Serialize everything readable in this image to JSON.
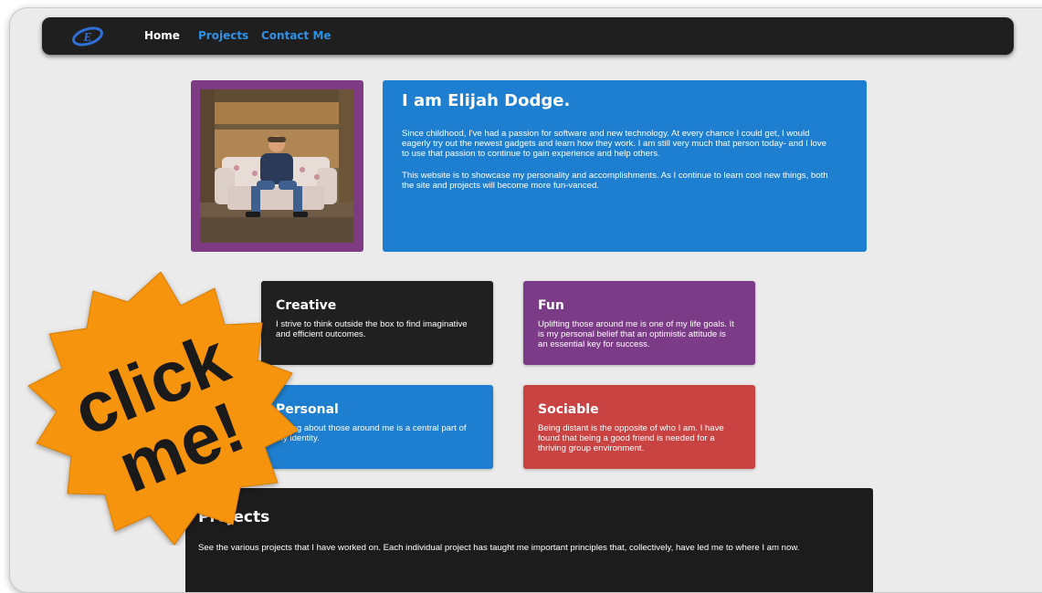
{
  "nav": {
    "links": [
      "Home",
      "Projects",
      "Contact Me"
    ]
  },
  "intro": {
    "title": "I am Elijah Dodge.",
    "paragraph1": "Since childhood, I've had a passion for software and new technology. At every chance I could get, I would eagerly try out the newest gadgets and learn how they work. I am still very much that person today- and I love to use that passion to continue to gain experience and help others.",
    "paragraph2": "This website is to showcase my personality and accomplishments. As I continue to learn cool new things, both the site and projects will become more fun-vanced."
  },
  "traits": [
    {
      "title": "Creative",
      "text": "I strive to think outside the box to find imaginative and efficient outcomes."
    },
    {
      "title": "Fun",
      "text": "Uplifting those around me is one of my life goals. It is my personal belief that an optimistic attitude is an essential key for success."
    },
    {
      "title": "Personal",
      "text": "Caring about those around me is a central part of my identity."
    },
    {
      "title": "Sociable",
      "text": "Being distant is the opposite of who I am. I have found that being a good friend is needed for a thriving group environment."
    }
  ],
  "projects": {
    "title": "Projects",
    "text": "See the various projects that I have worked on. Each individual project has taught me important principles that, collectively, have led me to where I am now."
  },
  "badge": {
    "line1": "click",
    "line2": "me!"
  },
  "colors": {
    "navbar": "#1f1f1f",
    "accent_blue": "#1e7fd0",
    "purple": "#7c3b86",
    "red": "#c94343",
    "badge_orange": "#f7940c"
  }
}
